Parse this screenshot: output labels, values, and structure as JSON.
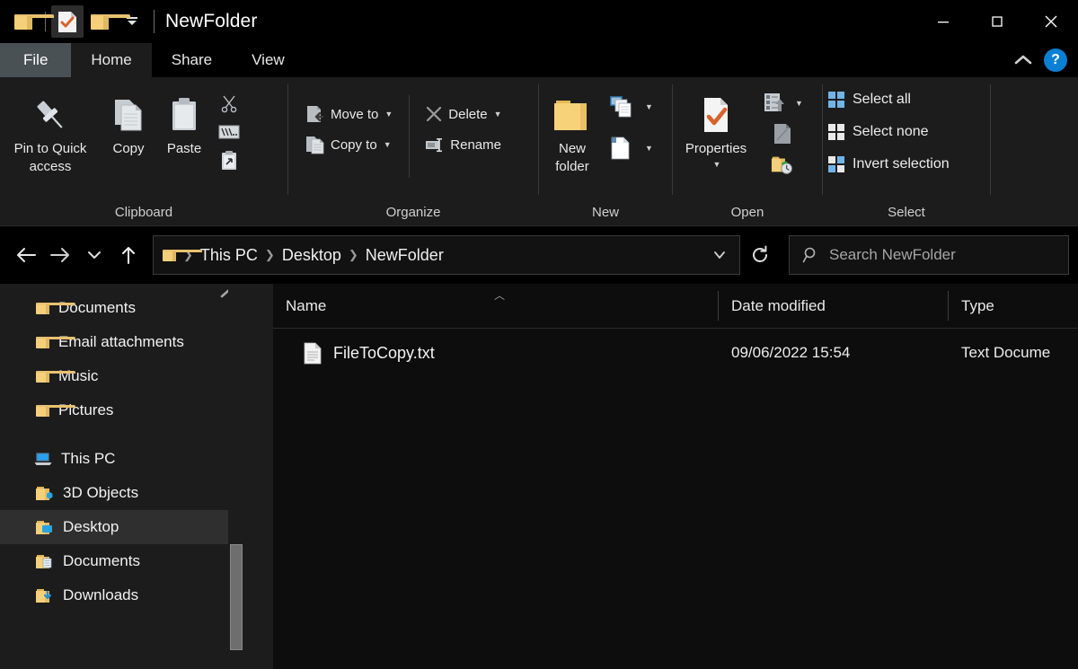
{
  "window": {
    "title": "NewFolder",
    "quick_access": [
      {
        "name": "folder-icon",
        "label": "Quick access folder"
      },
      {
        "name": "properties-icon",
        "label": "Properties"
      },
      {
        "name": "new-folder-icon",
        "label": "New folder"
      },
      {
        "name": "chevron-down-icon",
        "label": "Customize Quick Access Toolbar"
      }
    ],
    "controls": {
      "minimize": "Minimize",
      "maximize": "Maximize",
      "close": "Close"
    }
  },
  "tabs": [
    {
      "label": "File",
      "state": "file"
    },
    {
      "label": "Home",
      "state": "active"
    },
    {
      "label": "Share",
      "state": "normal"
    },
    {
      "label": "View",
      "state": "normal"
    }
  ],
  "tabstrip_right": {
    "collapse": "Collapse Ribbon",
    "help": "?"
  },
  "ribbon": {
    "groups": [
      {
        "label": "Clipboard",
        "big": [
          {
            "label": "Pin to Quick\naccess",
            "icon": "pin-icon"
          },
          {
            "label": "Copy",
            "icon": "copy-icon"
          },
          {
            "label": "Paste",
            "icon": "paste-icon"
          }
        ],
        "small_icons": [
          {
            "name": "cut-icon",
            "label": "Cut"
          },
          {
            "name": "copy-path-icon",
            "label": "Copy path"
          },
          {
            "name": "paste-shortcut-icon",
            "label": "Paste shortcut"
          }
        ]
      },
      {
        "label": "Organize",
        "buttons": [
          {
            "label": "Move to",
            "icon": "move-to-icon",
            "dropdown": true,
            "dim": false
          },
          {
            "label": "Copy to",
            "icon": "copy-to-icon",
            "dropdown": true,
            "dim": false
          },
          {
            "label": "Delete",
            "icon": "delete-icon",
            "dropdown": true,
            "dim": false
          },
          {
            "label": "Rename",
            "icon": "rename-icon",
            "dropdown": false,
            "dim": false
          }
        ]
      },
      {
        "label": "New",
        "big": [
          {
            "label": "New\nfolder",
            "icon": "new-folder-icon"
          }
        ],
        "small": [
          {
            "name": "new-item-icon",
            "label": "New item",
            "dropdown": true
          },
          {
            "name": "easy-access-icon",
            "label": "Easy access",
            "dropdown": true
          }
        ]
      },
      {
        "label": "Open",
        "big": [
          {
            "label": "Properties",
            "icon": "properties-icon",
            "dropdown": true
          }
        ],
        "small": [
          {
            "name": "open-icon",
            "label": "Open",
            "dropdown": true
          },
          {
            "name": "edit-icon",
            "label": "Edit",
            "dropdown": false
          },
          {
            "name": "history-icon",
            "label": "History",
            "dropdown": false
          }
        ]
      },
      {
        "label": "Select",
        "items": [
          {
            "label": "Select all",
            "icon": "select-all-icon"
          },
          {
            "label": "Select none",
            "icon": "select-none-icon"
          },
          {
            "label": "Invert selection",
            "icon": "invert-selection-icon"
          }
        ]
      }
    ]
  },
  "addressbar": {
    "back": "Back",
    "forward": "Forward",
    "recent": "Recent locations",
    "up": "Up",
    "breadcrumbs": [
      "This PC",
      "Desktop",
      "NewFolder"
    ],
    "dropdown": "Previous locations",
    "refresh": "Refresh",
    "search": {
      "placeholder": "Search NewFolder",
      "icon": "search-icon"
    }
  },
  "navpane": {
    "items": [
      {
        "label": "Documents",
        "icon": "folder-icon",
        "level": 1,
        "selected": false
      },
      {
        "label": "Email attachments",
        "icon": "folder-icon",
        "level": 1,
        "selected": false
      },
      {
        "label": "Music",
        "icon": "folder-icon",
        "level": 1,
        "selected": false
      },
      {
        "label": "Pictures",
        "icon": "folder-icon",
        "level": 1,
        "selected": false
      },
      {
        "label": "This PC",
        "icon": "this-pc-icon",
        "level": 0,
        "selected": false
      },
      {
        "label": "3D Objects",
        "icon": "folder-3d-icon",
        "level": 1,
        "selected": false
      },
      {
        "label": "Desktop",
        "icon": "folder-desktop-icon",
        "level": 1,
        "selected": true
      },
      {
        "label": "Documents",
        "icon": "folder-documents-icon",
        "level": 1,
        "selected": false
      },
      {
        "label": "Downloads",
        "icon": "folder-downloads-icon",
        "level": 1,
        "selected": false
      }
    ]
  },
  "filelist": {
    "columns": [
      {
        "label": "Name",
        "sorted": "asc"
      },
      {
        "label": "Date modified",
        "sorted": null
      },
      {
        "label": "Type",
        "sorted": null
      }
    ],
    "rows": [
      {
        "name": "FileToCopy.txt",
        "date_modified": "09/06/2022 15:54",
        "type": "Text Docume",
        "icon": "text-file-icon"
      }
    ]
  },
  "colors": {
    "accent": "#0a7fd4",
    "folder_yellow": "#f5cf7a",
    "checkmark_orange": "#d9622b",
    "file_tab": "#4a5155",
    "selection": "#2f2f2f"
  }
}
